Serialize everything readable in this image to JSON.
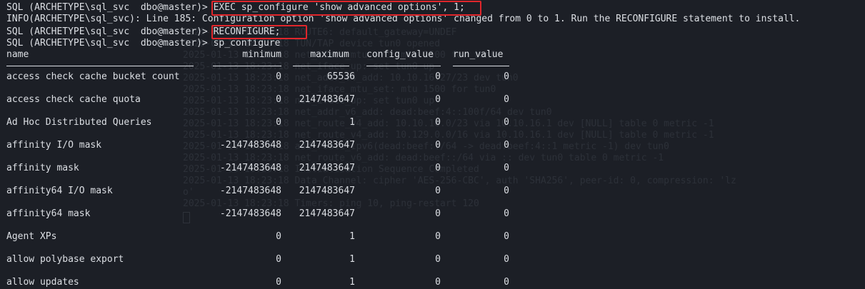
{
  "terminal": {
    "lines": [
      "SQL (ARCHETYPE\\sql_svc  dbo@master)> EXEC sp_configure 'show advanced options', 1;",
      "INFO(ARCHETYPE\\sql_svc): Line 185: Configuration option 'show advanced options' changed from 0 to 1. Run the RECONFIGURE statement to install.",
      "SQL (ARCHETYPE\\sql_svc  dbo@master)> RECONFIGURE;",
      "SQL (ARCHETYPE\\sql_svc  dbo@master)> sp_configure"
    ],
    "highlight_color": "#e0262b"
  },
  "table": {
    "headers": [
      "name",
      "minimum",
      "maximum",
      "config_value",
      "run_value"
    ],
    "rows": [
      {
        "name": "access check cache bucket count",
        "minimum": "0",
        "maximum": "65536",
        "config_value": "0",
        "run_value": "0"
      },
      {
        "name": "access check cache quota",
        "minimum": "0",
        "maximum": "2147483647",
        "config_value": "0",
        "run_value": "0"
      },
      {
        "name": "Ad Hoc Distributed Queries",
        "minimum": "0",
        "maximum": "1",
        "config_value": "0",
        "run_value": "0"
      },
      {
        "name": "affinity I/O mask",
        "minimum": "-2147483648",
        "maximum": "2147483647",
        "config_value": "0",
        "run_value": "0"
      },
      {
        "name": "affinity mask",
        "minimum": "-2147483648",
        "maximum": "2147483647",
        "config_value": "0",
        "run_value": "0"
      },
      {
        "name": "affinity64 I/O mask",
        "minimum": "-2147483648",
        "maximum": "2147483647",
        "config_value": "0",
        "run_value": "0"
      },
      {
        "name": "affinity64 mask",
        "minimum": "-2147483648",
        "maximum": "2147483647",
        "config_value": "0",
        "run_value": "0"
      },
      {
        "name": "Agent XPs",
        "minimum": "0",
        "maximum": "1",
        "config_value": "0",
        "run_value": "0"
      },
      {
        "name": "allow polybase export",
        "minimum": "0",
        "maximum": "1",
        "config_value": "0",
        "run_value": "0"
      },
      {
        "name": "allow updates",
        "minimum": "0",
        "maximum": "1",
        "config_value": "0",
        "run_value": "0"
      }
    ]
  },
  "background_log": [
    "2025-01-13 18:23:18 ROUTE6: default_gateway=UNDEF",
    "2025-01-13 18:23:18 TUN/TAP device tun0 opened",
    "2025-01-13 18:23:18 net_iface_mtu_set: mtu 1500 for tun0",
    "2025-01-13 18:23:18 net_iface_up: set tun0 up",
    "2025-01-13 18:23:18 net_addr_v4_add: 10.10.16.27/23 dev tun0",
    "2025-01-13 18:23:18 net_iface_mtu_set: mtu 1500 for tun0",
    "2025-01-13 18:23:18 net_iface_up: set tun0 up",
    "2025-01-13 18:23:18 net_addr_v6_add: dead:beef:4::100f/64 dev tun0",
    "2025-01-13 18:23:18 net_route_v4_add: 10.10.10.0/23 via 10.10.16.1 dev [NULL] table 0 metric -1",
    "2025-01-13 18:23:18 net_route_v4_add: 10.129.0.0/16 via 10.10.16.1 dev [NULL] table 0 metric -1",
    "2025-01-13 18:23:18 add_route_ipv6(dead:beef::/64 -> dead:beef:4::1 metric -1) dev tun0",
    "2025-01-13 18:23:18 net_route_v6_add: dead:beef::/64 via :: dev tun0 table 0 metric -1",
    "2025-01-13 18:23:18 Initialization Sequence Completed",
    "2025-01-13 18:23:18 Data Channel: cipher 'AES-256-CBC', auth 'SHA256', peer-id: 0, compression: 'lz",
    "o'",
    "2025-01-13 18:23:18 Timers: ping 10, ping-restart 120"
  ]
}
